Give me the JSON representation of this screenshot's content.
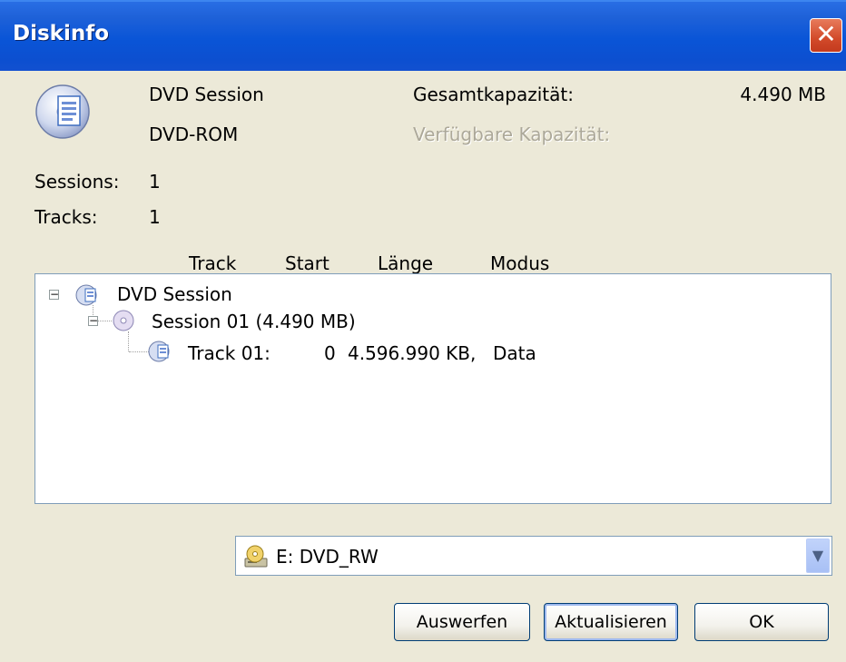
{
  "window": {
    "title": "Diskinfo"
  },
  "disc": {
    "name": "DVD Session",
    "type": "DVD-ROM",
    "total_capacity_label": "Gesamtkapazität:",
    "total_capacity_value": "4.490 MB",
    "available_capacity_label": "Verfügbare Kapazität:",
    "sessions_label": "Sessions:",
    "sessions_value": "1",
    "tracks_label": "Tracks:",
    "tracks_value": "1"
  },
  "tree": {
    "columns": [
      "Track",
      "Start",
      "Länge",
      "Modus"
    ],
    "root": {
      "label": "DVD Session"
    },
    "session": {
      "label": "Session 01 (4.490 MB)"
    },
    "track": {
      "name": "Track 01:",
      "start": "0",
      "length": "4.596.990 KB,",
      "mode": "Data"
    }
  },
  "drive_select": {
    "value": "E: DVD_RW"
  },
  "buttons": {
    "eject": "Auswerfen",
    "refresh": "Aktualisieren",
    "ok": "OK"
  },
  "colors": {
    "titlebar": "#0A55D7",
    "close": "#D24A2A",
    "window_bg": "#ECE9D8"
  }
}
